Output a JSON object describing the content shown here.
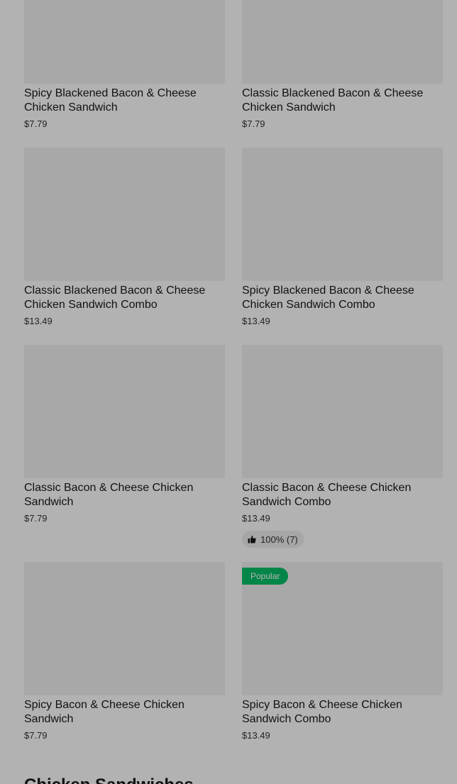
{
  "items": [
    {
      "name": "Spicy Blackened Bacon & Cheese Chicken Sandwich",
      "price": "$7.79"
    },
    {
      "name": "Classic Blackened Bacon & Cheese Chicken Sandwich",
      "price": "$7.79"
    },
    {
      "name": "Classic Blackened Bacon & Cheese Chicken Sandwich Combo",
      "price": "$13.49"
    },
    {
      "name": "Spicy Blackened Bacon & Cheese Chicken Sandwich Combo",
      "price": "$13.49"
    },
    {
      "name": "Classic Bacon & Cheese Chicken Sandwich",
      "price": "$7.79"
    },
    {
      "name": "Classic Bacon & Cheese Chicken Sandwich Combo",
      "price": "$13.49",
      "rating": "100% (7)",
      "rating_icon": "thumbs-up-icon"
    },
    {
      "name": "Spicy Bacon & Cheese Chicken Sandwich",
      "price": "$7.79"
    },
    {
      "name": "Spicy Bacon & Cheese Chicken Sandwich Combo",
      "price": "$13.49",
      "badge": "Popular"
    }
  ],
  "next_section_title": "Chicken Sandwiches",
  "colors": {
    "badge_bg": "#06c167",
    "overlay": "rgba(0,0,0,0.3)"
  }
}
